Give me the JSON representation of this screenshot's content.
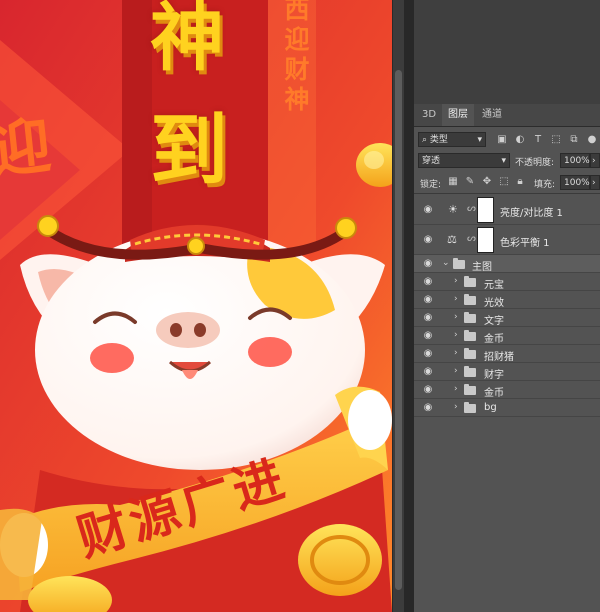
{
  "canvas": {
    "top_chars": [
      "神",
      "到"
    ],
    "side_chars": [
      "西",
      "迎",
      "财",
      "神"
    ],
    "left_char": "迎",
    "banner_text": "财源广进",
    "colors": {
      "background": "#e9442c",
      "gold": "#ffd21f",
      "banner": "#f9b42c",
      "banner_text": "#d9281b",
      "pig_body": "#ffffff",
      "hat": "#c8281e"
    }
  },
  "panel": {
    "tabs": [
      {
        "label": "3D",
        "active": false
      },
      {
        "label": "图层",
        "active": true
      },
      {
        "label": "通道",
        "active": false
      }
    ],
    "filter_kind": "类型",
    "blend_mode": "穿透",
    "opacity_label": "不透明度:",
    "opacity_value": "100%",
    "lock_label": "锁定:",
    "fill_label": "填充:",
    "fill_value": "100%",
    "layers": [
      {
        "name": "亮度/对比度 1",
        "kind": "adjustment",
        "icon": "sun-icon"
      },
      {
        "name": "色彩平衡 1",
        "kind": "adjustment",
        "icon": "balance-icon"
      },
      {
        "name": "主图",
        "kind": "group-open"
      },
      {
        "name": "元宝",
        "kind": "group"
      },
      {
        "name": "光效",
        "kind": "group"
      },
      {
        "name": "文字",
        "kind": "group"
      },
      {
        "name": "金币",
        "kind": "group"
      },
      {
        "name": "招财猪",
        "kind": "group"
      },
      {
        "name": "财字",
        "kind": "group"
      },
      {
        "name": "金币",
        "kind": "group"
      },
      {
        "name": "bg",
        "kind": "group"
      }
    ]
  }
}
